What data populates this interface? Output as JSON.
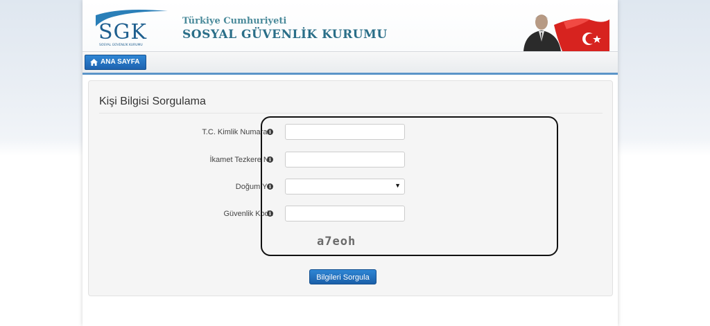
{
  "header": {
    "logo_text": "SGK",
    "logo_subtext": "SOSYAL GÜVENLİK KURUMU",
    "title_line1": "Türkiye Cumhuriyeti",
    "title_line2": "SOSYAL GÜVENLİK KURUMU"
  },
  "nav": {
    "home_label": "ANA SAYFA",
    "home_icon": "home-icon"
  },
  "form": {
    "title": "Kişi Bilgisi Sorgulama",
    "fields": [
      {
        "label": "T.C. Kimlik Numarası",
        "value": "",
        "icon": "info-icon"
      },
      {
        "label": "İkamet Tezkere No",
        "value": "",
        "icon": "info-icon"
      },
      {
        "label": "Doğum Yılı",
        "value": "",
        "icon": "info-icon"
      },
      {
        "label": "Güvenlik Kodu",
        "value": "",
        "icon": "info-icon"
      }
    ],
    "captcha_text": "a7eoh",
    "submit_label": "Bilgileri Sorgula"
  },
  "colors": {
    "accent": "#1e63b0",
    "title_teal": "#2a6e88",
    "nav_rule": "#5b95c9"
  }
}
